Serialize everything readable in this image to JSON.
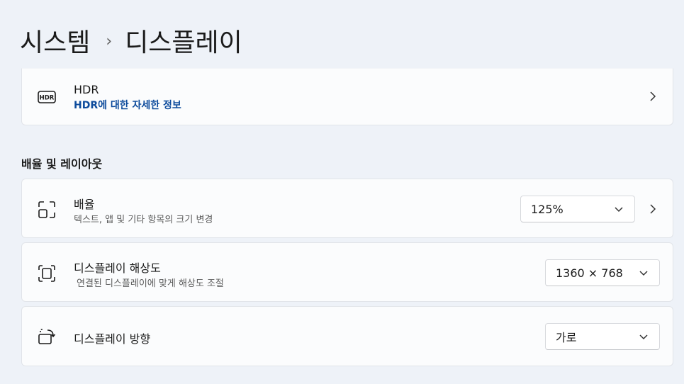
{
  "breadcrumb": {
    "parent": "시스템",
    "separator": "›",
    "current": "디스플레이"
  },
  "hdr": {
    "icon": "hdr-icon",
    "title": "HDR",
    "link": "HDR에 대한 자세한 정보"
  },
  "scale_section": {
    "title": "배율 및 레이아웃"
  },
  "scale": {
    "icon": "scale-icon",
    "title": "배율",
    "subtitle": "텍스트, 앱 및 기타 항목의 크기 변경",
    "value": "125%"
  },
  "resolution": {
    "icon": "resolution-icon",
    "title": "디스플레이 해상도",
    "subtitle": "연결된 디스플레이에 맞게 해상도 조절",
    "value": "1360 × 768"
  },
  "orientation": {
    "icon": "orientation-icon",
    "title": "디스플레이 방향",
    "value": "가로"
  },
  "colors": {
    "link": "#0d4b9c",
    "background": "#eef2f8",
    "card": "#fbfcfd"
  }
}
